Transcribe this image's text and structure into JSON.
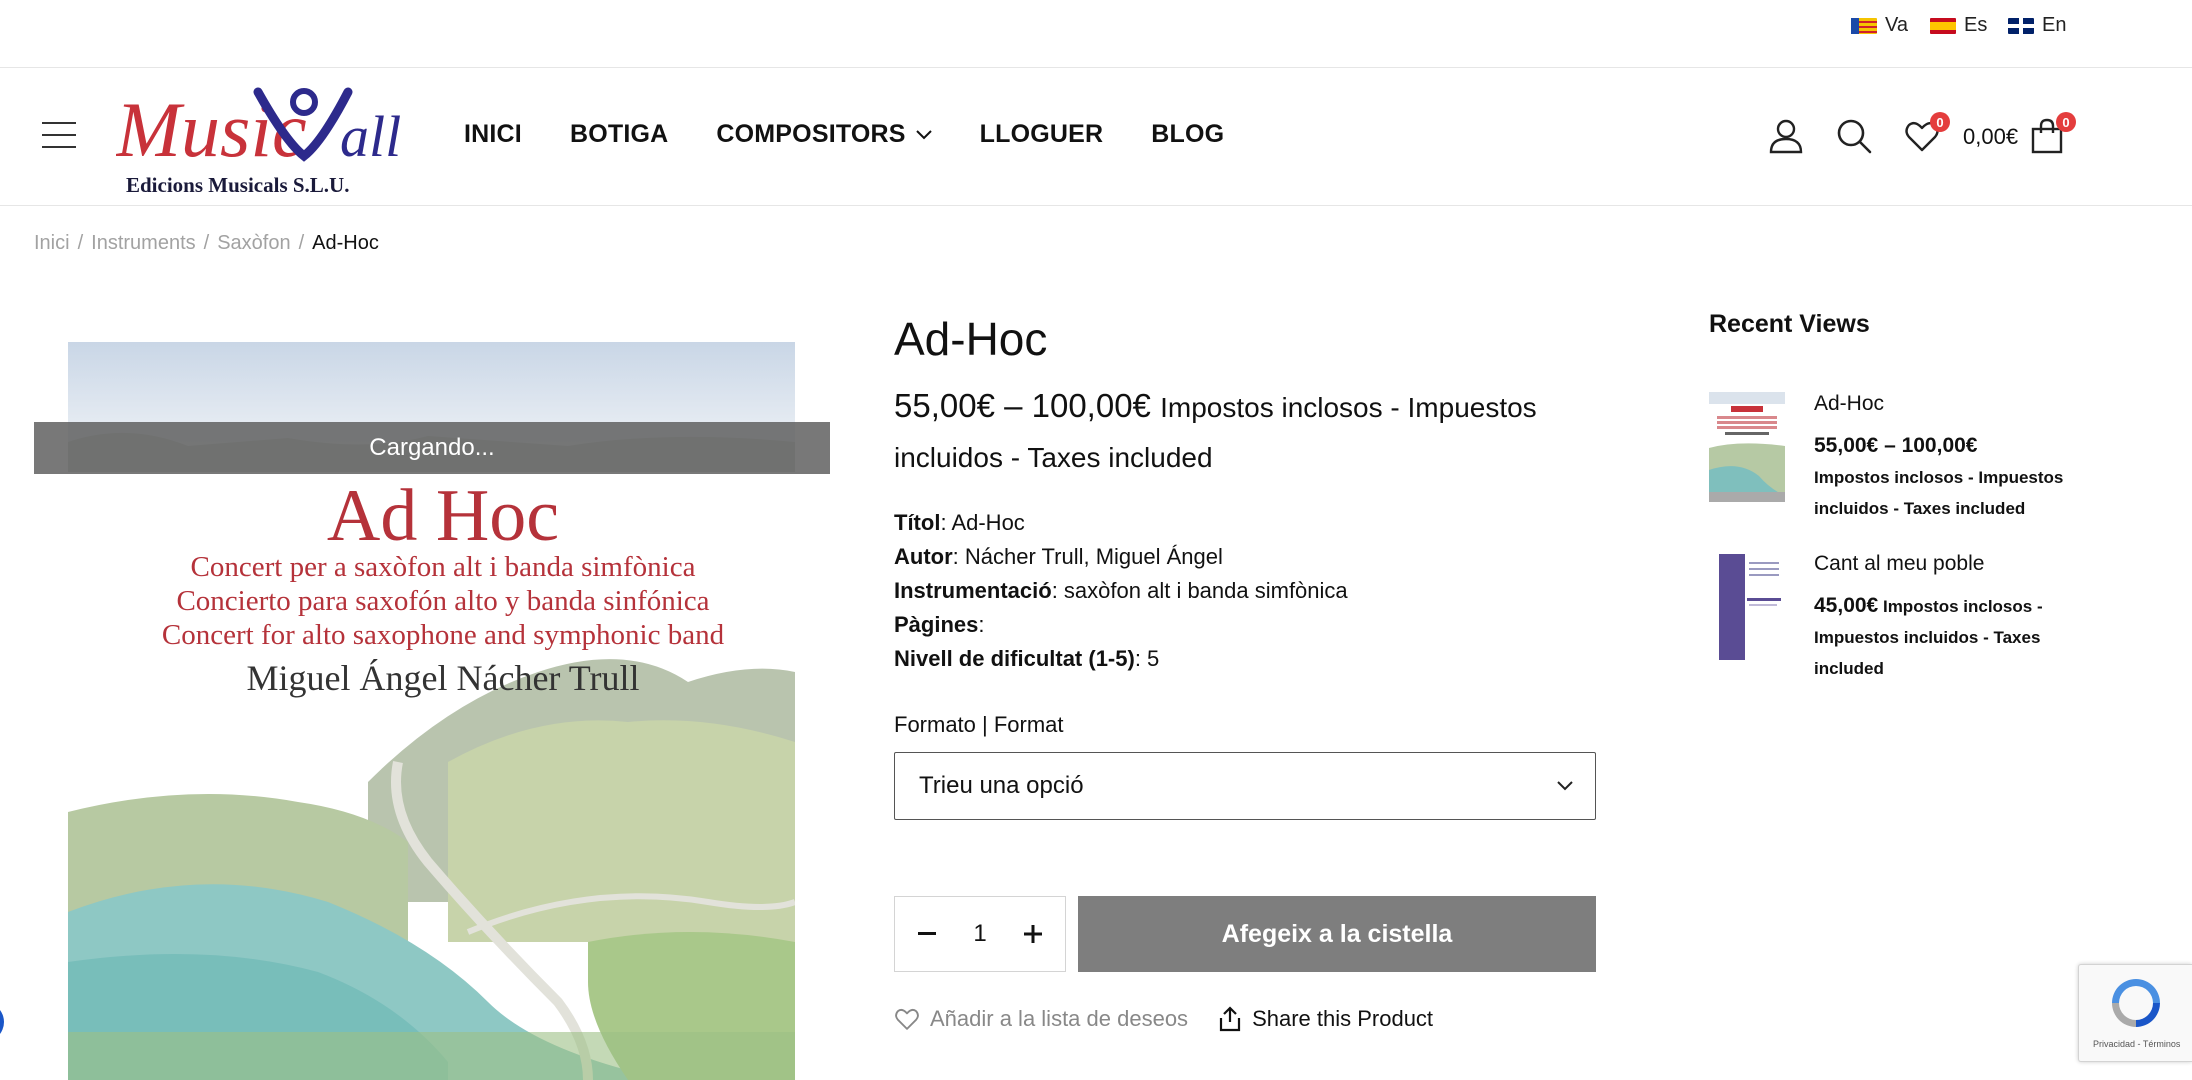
{
  "languages": [
    {
      "code": "va",
      "label": "Va"
    },
    {
      "code": "es",
      "label": "Es"
    },
    {
      "code": "en",
      "label": "En"
    }
  ],
  "logo": {
    "word1": "Music",
    "word2": "all",
    "tagline": "Edicions Musicals S.L.U.",
    "primary_color": "#c8323a",
    "secondary_color": "#2d2a8c"
  },
  "nav": {
    "items": [
      "INICI",
      "BOTIGA",
      "COMPOSITORS",
      "LLOGUER",
      "BLOG"
    ]
  },
  "header": {
    "wishlist_count": "0",
    "cart_count": "0",
    "cart_total": "0,00€"
  },
  "breadcrumb": {
    "items": [
      "Inici",
      "Instruments",
      "Saxòfon"
    ],
    "current": "Ad-Hoc",
    "separator": "/"
  },
  "gallery": {
    "loading_text": "Cargando...",
    "cover_title": "Ad Hoc",
    "cover_lines": [
      "Concert per a saxòfon alt i banda simfònica",
      "Concierto para saxofón alto y banda sinfónica",
      "Concert for alto saxophone and symphonic band"
    ],
    "cover_author": "Miguel Ángel Nácher Trull"
  },
  "product": {
    "title": "Ad-Hoc",
    "price_range": "55,00€ – 100,00€",
    "tax_note": "Impostos inclosos - Impuestos incluidos - Taxes included",
    "attributes": [
      {
        "label": "Títol",
        "value": ": Ad-Hoc"
      },
      {
        "label": "Autor",
        "value": ": Nácher Trull, Miguel Ángel"
      },
      {
        "label": "Instrumentació",
        "value": ": saxòfon alt i banda simfònica"
      },
      {
        "label": "Pàgines",
        "value": ":"
      },
      {
        "label": "Nivell de dificultat (1-5)",
        "value": ": 5"
      }
    ],
    "variation_label": "Formato | Format",
    "variation_placeholder": "Trieu una opció",
    "quantity": "1",
    "add_to_cart": "Afegeix a la cistella",
    "wishlist": "Añadir a la lista de deseos",
    "share": "Share this Product"
  },
  "recent_views": {
    "title": "Recent Views",
    "items": [
      {
        "name": "Ad-Hoc",
        "price": "55,00€ – 100,00€",
        "tax": "Impostos inclosos - Impuestos incluidos - Taxes included"
      },
      {
        "name": "Cant al meu poble",
        "price": "45,00€",
        "tax": "Impostos inclosos - Impuestos incluidos - Taxes included"
      }
    ]
  },
  "recaptcha": {
    "text": "Privacidad - Términos"
  }
}
